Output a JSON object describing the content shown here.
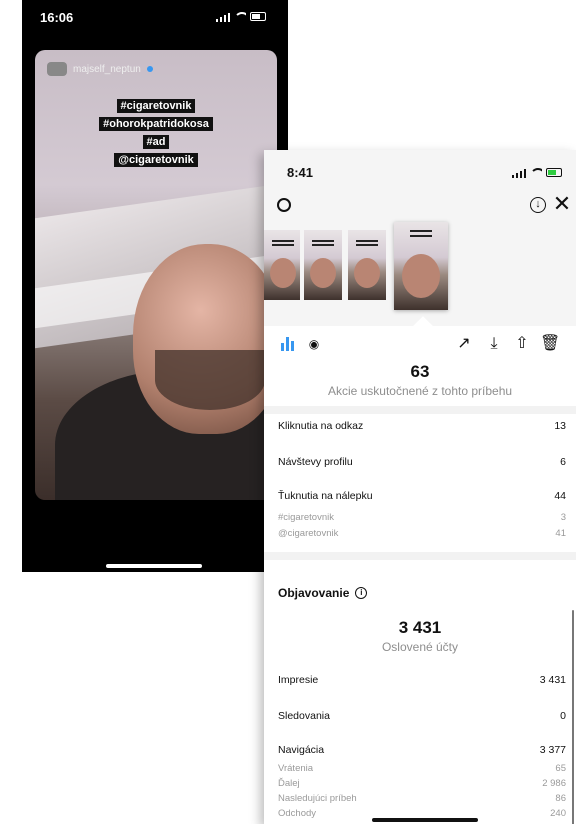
{
  "left_phone": {
    "time": "16:06",
    "username": "majself_neptun",
    "stickers": [
      "#cigaretovnik",
      "#ohorokpatridokosa",
      "#ad",
      "@cigaretovnik"
    ]
  },
  "right_phone": {
    "time": "8:41",
    "total_actions": {
      "value": "63",
      "caption": "Akcie uskutočnené z tohto príbehu"
    },
    "interactions": [
      {
        "label": "Kliknutia na odkaz",
        "value": "13"
      },
      {
        "label": "Návštevy profilu",
        "value": "6"
      },
      {
        "label": "Ťuknutia na nálepku",
        "value": "44"
      }
    ],
    "sticker_taps": [
      {
        "label": "#cigaretovnik",
        "value": "3"
      },
      {
        "label": "@cigaretovnik",
        "value": "41"
      }
    ],
    "discovery": {
      "title": "Objavovanie",
      "reach_value": "3 431",
      "reach_caption": "Oslovené účty",
      "rows": [
        {
          "label": "Impresie",
          "value": "3 431"
        },
        {
          "label": "Sledovania",
          "value": "0"
        },
        {
          "label": "Navigácia",
          "value": "3 377"
        }
      ],
      "navigation": [
        {
          "label": "Vrátenia",
          "value": "65"
        },
        {
          "label": "Ďalej",
          "value": "2 986"
        },
        {
          "label": "Nasledujúci príbeh",
          "value": "86"
        },
        {
          "label": "Odchody",
          "value": "240"
        }
      ]
    }
  },
  "colors": {
    "accent": "#3797f0",
    "muted": "#9a9a9a"
  },
  "icons": [
    "settings-icon",
    "download-icon",
    "close-icon",
    "insights-chart-icon",
    "eye-icon",
    "promote-icon",
    "save-icon",
    "share-icon",
    "delete-icon",
    "info-icon"
  ]
}
